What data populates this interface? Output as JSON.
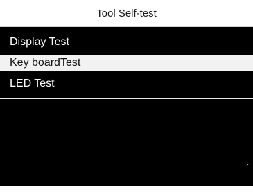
{
  "header": {
    "title": "Tool Self-test"
  },
  "menu": {
    "items": [
      {
        "label": "Display Test",
        "selected": false
      },
      {
        "label": "Key boardTest",
        "selected": true
      },
      {
        "label": "LED Test",
        "selected": false
      }
    ]
  },
  "colors": {
    "screen_background": "#000000",
    "title_background": "#ffffff",
    "selected_background": "#f2f2f2",
    "text_light": "#ffffff",
    "text_dark": "#111111"
  }
}
